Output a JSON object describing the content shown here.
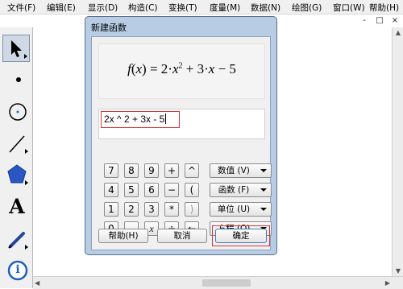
{
  "menu": {
    "items": [
      "文件(F)",
      "编辑(E)",
      "显示(D)",
      "构造(C)",
      "变换(T)",
      "度量(M)",
      "数据(N)",
      "绘图(G)",
      "窗口(W)",
      "帮助(H)"
    ],
    "window_buttons": [
      "-",
      "□",
      "×"
    ]
  },
  "toolbox": {
    "tools": [
      "selection-arrow-icon",
      "point-icon",
      "compass-icon",
      "straightedge-icon",
      "polygon-icon",
      "text-icon",
      "marker-icon",
      "information-icon"
    ],
    "selected": "selection-arrow-icon",
    "text_glyph": "A",
    "info_glyph": "i"
  },
  "dialog": {
    "title": "新建函数",
    "formula": {
      "name": "f",
      "var": "x",
      "eq": " = 2·",
      "exp": "2",
      "plus": " + 3·",
      "minus": " − 5"
    },
    "expression": "2x ^ 2 + 3x - 5",
    "keys": [
      [
        "7",
        "8",
        "9",
        "+",
        "^"
      ],
      [
        "4",
        "5",
        "6",
        "−",
        "("
      ],
      [
        "1",
        "2",
        "3",
        "*",
        ")"
      ],
      [
        "0",
        ".",
        "x",
        "÷",
        "←"
      ]
    ],
    "dropdowns": [
      "数值 (V)",
      "函数 (F)",
      "单位 (U)",
      "方程 (Q)"
    ],
    "buttons": {
      "help": "帮助(H)",
      "cancel": "取消",
      "ok": "确定"
    },
    "highlight_color": "#d9343a"
  }
}
